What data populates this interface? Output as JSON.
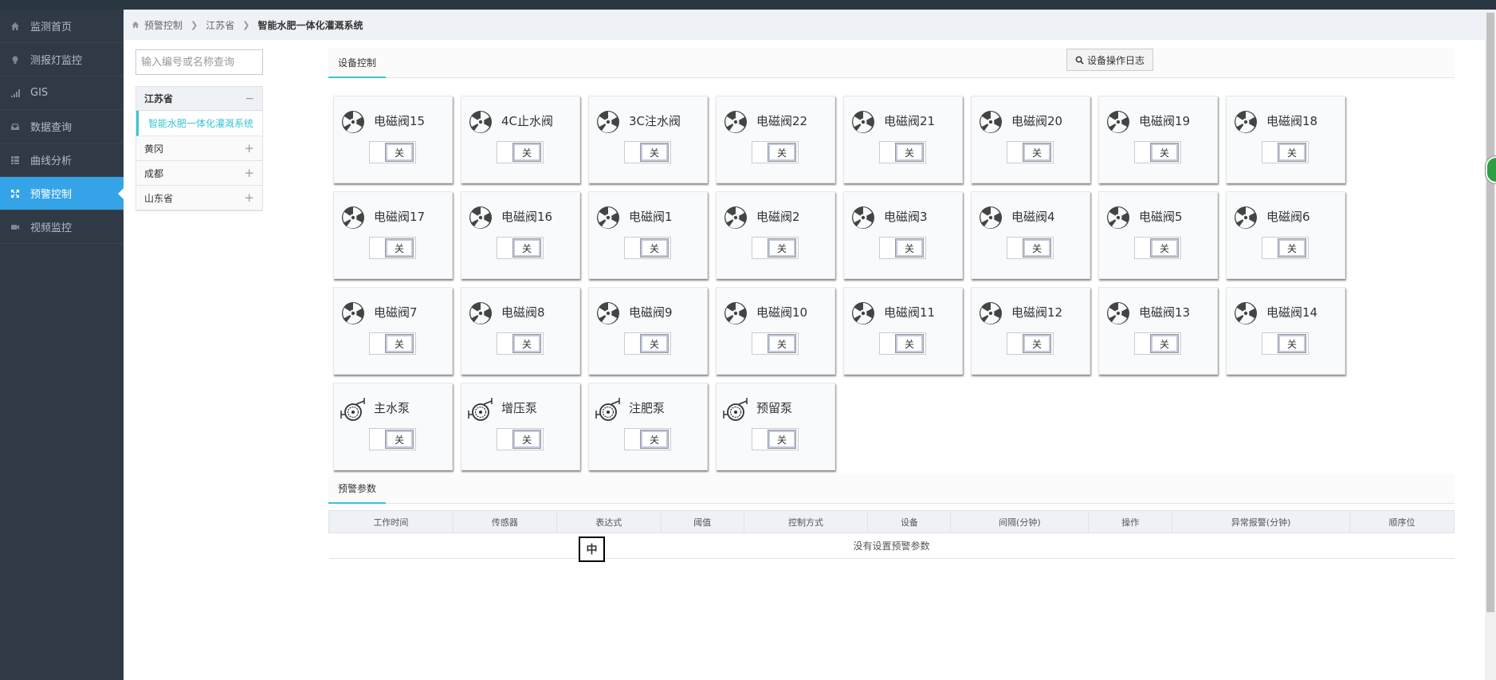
{
  "nav": {
    "items": [
      {
        "label": "监测首页",
        "icon": "home-icon"
      },
      {
        "label": "测报灯监控",
        "icon": "lightbulb-icon"
      },
      {
        "label": "GIS",
        "icon": "signal-icon"
      },
      {
        "label": "数据查询",
        "icon": "inbox-icon"
      },
      {
        "label": "曲线分析",
        "icon": "grid-icon"
      },
      {
        "label": "预警控制",
        "icon": "arrows-icon",
        "active": true
      },
      {
        "label": "视频监控",
        "icon": "camera-icon"
      }
    ]
  },
  "breadcrumb": {
    "items": [
      "预警控制",
      "江苏省",
      "智能水肥一体化灌溉系统"
    ]
  },
  "search": {
    "placeholder": "输入编号或名称查询",
    "value": ""
  },
  "tree": {
    "group": "江苏省",
    "group_toggle": "−",
    "selected_child": "智能水肥一体化灌溉系统",
    "rows": [
      {
        "label": "黄冈",
        "toggle": "+"
      },
      {
        "label": "成都",
        "toggle": "+"
      },
      {
        "label": "山东省",
        "toggle": "+"
      }
    ]
  },
  "device_section": {
    "tab_label": "设备控制",
    "log_button": "设备操作日志"
  },
  "devices": [
    {
      "label": "电磁阀15",
      "type": "fan",
      "state": "关"
    },
    {
      "label": "4C止水阀",
      "type": "fan",
      "state": "关"
    },
    {
      "label": "3C注水阀",
      "type": "fan",
      "state": "关"
    },
    {
      "label": "电磁阀22",
      "type": "fan",
      "state": "关"
    },
    {
      "label": "电磁阀21",
      "type": "fan",
      "state": "关"
    },
    {
      "label": "电磁阀20",
      "type": "fan",
      "state": "关"
    },
    {
      "label": "电磁阀19",
      "type": "fan",
      "state": "关"
    },
    {
      "label": "电磁阀18",
      "type": "fan",
      "state": "关"
    },
    {
      "label": "电磁阀17",
      "type": "fan",
      "state": "关"
    },
    {
      "label": "电磁阀16",
      "type": "fan",
      "state": "关"
    },
    {
      "label": "电磁阀1",
      "type": "fan",
      "state": "关"
    },
    {
      "label": "电磁阀2",
      "type": "fan",
      "state": "关"
    },
    {
      "label": "电磁阀3",
      "type": "fan",
      "state": "关"
    },
    {
      "label": "电磁阀4",
      "type": "fan",
      "state": "关"
    },
    {
      "label": "电磁阀5",
      "type": "fan",
      "state": "关"
    },
    {
      "label": "电磁阀6",
      "type": "fan",
      "state": "关"
    },
    {
      "label": "电磁阀7",
      "type": "fan",
      "state": "关"
    },
    {
      "label": "电磁阀8",
      "type": "fan",
      "state": "关"
    },
    {
      "label": "电磁阀9",
      "type": "fan",
      "state": "关"
    },
    {
      "label": "电磁阀10",
      "type": "fan",
      "state": "关"
    },
    {
      "label": "电磁阀11",
      "type": "fan",
      "state": "关"
    },
    {
      "label": "电磁阀12",
      "type": "fan",
      "state": "关"
    },
    {
      "label": "电磁阀13",
      "type": "fan",
      "state": "关"
    },
    {
      "label": "电磁阀14",
      "type": "fan",
      "state": "关"
    },
    {
      "label": "主水泵",
      "type": "pump",
      "state": "关"
    },
    {
      "label": "增压泵",
      "type": "pump",
      "state": "关"
    },
    {
      "label": "注肥泵",
      "type": "pump",
      "state": "关"
    },
    {
      "label": "预留泵",
      "type": "pump",
      "state": "关"
    }
  ],
  "alarm_section": {
    "tab_label": "预警参数",
    "columns": [
      "工作时间",
      "传感器",
      "表达式",
      "阈值",
      "控制方式",
      "设备",
      "间隔(分钟)",
      "操作",
      "异常报警(分钟)",
      "顺序位"
    ],
    "empty_text": "没有设置预警参数"
  },
  "ime": {
    "label": "中"
  },
  "colors": {
    "sidebar": "#2f3a46",
    "active": "#35a3e8",
    "accent": "#36c6d3",
    "topbar": "#2b3643"
  }
}
